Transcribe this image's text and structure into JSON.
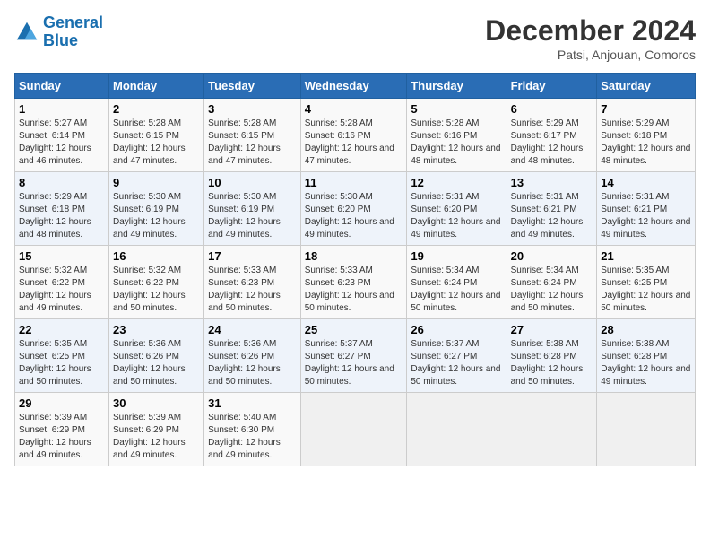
{
  "header": {
    "logo_general": "General",
    "logo_blue": "Blue",
    "title": "December 2024",
    "subtitle": "Patsi, Anjouan, Comoros"
  },
  "weekdays": [
    "Sunday",
    "Monday",
    "Tuesday",
    "Wednesday",
    "Thursday",
    "Friday",
    "Saturday"
  ],
  "weeks": [
    [
      {
        "day": "1",
        "sunrise": "5:27 AM",
        "sunset": "6:14 PM",
        "daylight": "12 hours and 46 minutes."
      },
      {
        "day": "2",
        "sunrise": "5:28 AM",
        "sunset": "6:15 PM",
        "daylight": "12 hours and 47 minutes."
      },
      {
        "day": "3",
        "sunrise": "5:28 AM",
        "sunset": "6:15 PM",
        "daylight": "12 hours and 47 minutes."
      },
      {
        "day": "4",
        "sunrise": "5:28 AM",
        "sunset": "6:16 PM",
        "daylight": "12 hours and 47 minutes."
      },
      {
        "day": "5",
        "sunrise": "5:28 AM",
        "sunset": "6:16 PM",
        "daylight": "12 hours and 48 minutes."
      },
      {
        "day": "6",
        "sunrise": "5:29 AM",
        "sunset": "6:17 PM",
        "daylight": "12 hours and 48 minutes."
      },
      {
        "day": "7",
        "sunrise": "5:29 AM",
        "sunset": "6:18 PM",
        "daylight": "12 hours and 48 minutes."
      }
    ],
    [
      {
        "day": "8",
        "sunrise": "5:29 AM",
        "sunset": "6:18 PM",
        "daylight": "12 hours and 48 minutes."
      },
      {
        "day": "9",
        "sunrise": "5:30 AM",
        "sunset": "6:19 PM",
        "daylight": "12 hours and 49 minutes."
      },
      {
        "day": "10",
        "sunrise": "5:30 AM",
        "sunset": "6:19 PM",
        "daylight": "12 hours and 49 minutes."
      },
      {
        "day": "11",
        "sunrise": "5:30 AM",
        "sunset": "6:20 PM",
        "daylight": "12 hours and 49 minutes."
      },
      {
        "day": "12",
        "sunrise": "5:31 AM",
        "sunset": "6:20 PM",
        "daylight": "12 hours and 49 minutes."
      },
      {
        "day": "13",
        "sunrise": "5:31 AM",
        "sunset": "6:21 PM",
        "daylight": "12 hours and 49 minutes."
      },
      {
        "day": "14",
        "sunrise": "5:31 AM",
        "sunset": "6:21 PM",
        "daylight": "12 hours and 49 minutes."
      }
    ],
    [
      {
        "day": "15",
        "sunrise": "5:32 AM",
        "sunset": "6:22 PM",
        "daylight": "12 hours and 49 minutes."
      },
      {
        "day": "16",
        "sunrise": "5:32 AM",
        "sunset": "6:22 PM",
        "daylight": "12 hours and 50 minutes."
      },
      {
        "day": "17",
        "sunrise": "5:33 AM",
        "sunset": "6:23 PM",
        "daylight": "12 hours and 50 minutes."
      },
      {
        "day": "18",
        "sunrise": "5:33 AM",
        "sunset": "6:23 PM",
        "daylight": "12 hours and 50 minutes."
      },
      {
        "day": "19",
        "sunrise": "5:34 AM",
        "sunset": "6:24 PM",
        "daylight": "12 hours and 50 minutes."
      },
      {
        "day": "20",
        "sunrise": "5:34 AM",
        "sunset": "6:24 PM",
        "daylight": "12 hours and 50 minutes."
      },
      {
        "day": "21",
        "sunrise": "5:35 AM",
        "sunset": "6:25 PM",
        "daylight": "12 hours and 50 minutes."
      }
    ],
    [
      {
        "day": "22",
        "sunrise": "5:35 AM",
        "sunset": "6:25 PM",
        "daylight": "12 hours and 50 minutes."
      },
      {
        "day": "23",
        "sunrise": "5:36 AM",
        "sunset": "6:26 PM",
        "daylight": "12 hours and 50 minutes."
      },
      {
        "day": "24",
        "sunrise": "5:36 AM",
        "sunset": "6:26 PM",
        "daylight": "12 hours and 50 minutes."
      },
      {
        "day": "25",
        "sunrise": "5:37 AM",
        "sunset": "6:27 PM",
        "daylight": "12 hours and 50 minutes."
      },
      {
        "day": "26",
        "sunrise": "5:37 AM",
        "sunset": "6:27 PM",
        "daylight": "12 hours and 50 minutes."
      },
      {
        "day": "27",
        "sunrise": "5:38 AM",
        "sunset": "6:28 PM",
        "daylight": "12 hours and 50 minutes."
      },
      {
        "day": "28",
        "sunrise": "5:38 AM",
        "sunset": "6:28 PM",
        "daylight": "12 hours and 49 minutes."
      }
    ],
    [
      {
        "day": "29",
        "sunrise": "5:39 AM",
        "sunset": "6:29 PM",
        "daylight": "12 hours and 49 minutes."
      },
      {
        "day": "30",
        "sunrise": "5:39 AM",
        "sunset": "6:29 PM",
        "daylight": "12 hours and 49 minutes."
      },
      {
        "day": "31",
        "sunrise": "5:40 AM",
        "sunset": "6:30 PM",
        "daylight": "12 hours and 49 minutes."
      },
      null,
      null,
      null,
      null
    ]
  ],
  "labels": {
    "sunrise": "Sunrise:",
    "sunset": "Sunset:",
    "daylight": "Daylight:"
  }
}
